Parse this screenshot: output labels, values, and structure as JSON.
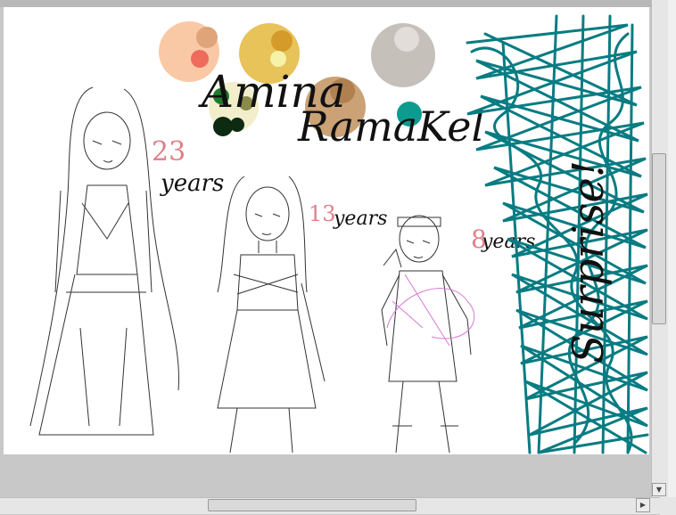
{
  "canvas": {
    "title_line1": "Amina",
    "title_line2": "RamaKel",
    "age_1_number": "23",
    "age_1_unit": "years",
    "age_2_number": "13",
    "age_2_unit": "years",
    "age_3_number": "8",
    "age_3_unit": "years",
    "surprise_label": "Surprise!"
  },
  "palette": {
    "colors": [
      "#f9c9a6",
      "#e8c35a",
      "#c6c0ba",
      "#caa276",
      "#f2eecb",
      "#1f7a2e",
      "#0b7a7e"
    ]
  },
  "scrollbars": {
    "down_glyph": "▼",
    "right_glyph": "▶"
  }
}
